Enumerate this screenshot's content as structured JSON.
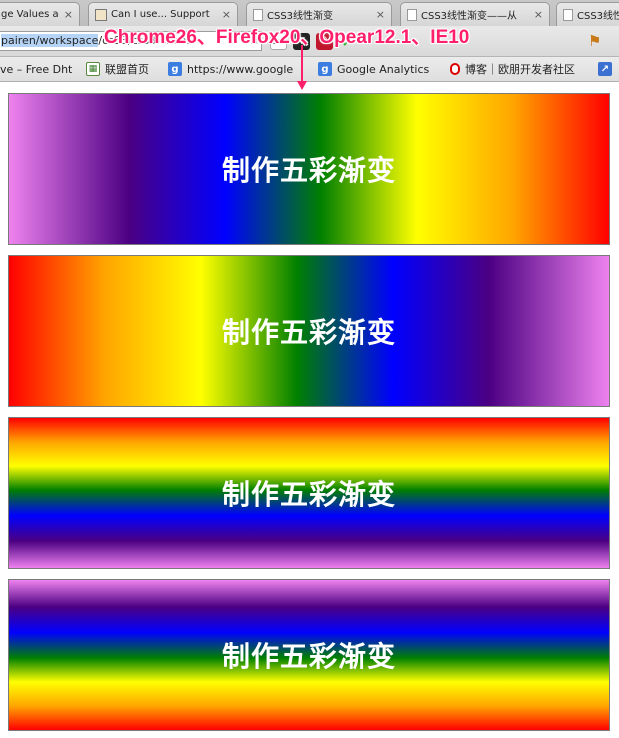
{
  "tabs": [
    {
      "label": "ge Values a",
      "icon": "none"
    },
    {
      "label": "Can I use... Support",
      "icon": "favicon-icon"
    },
    {
      "label": "CSS3线性渐变",
      "icon": "document-icon"
    },
    {
      "label": "CSS3线性渐变——从",
      "icon": "document-icon"
    },
    {
      "label": "CSS3线性",
      "icon": "document-icon"
    }
  ],
  "tab_close_glyph": "×",
  "address_bar": {
    "selected_text": "pairen/workspace",
    "rest_text": "/csS3/css3-linear"
  },
  "toolbar": {
    "star_glyph": "☆",
    "extensions": [
      {
        "name": "css-extension-icon",
        "label": "css"
      },
      {
        "name": "v-extension-icon",
        "label": "▼"
      },
      {
        "name": "red-extension-icon",
        "label": "9"
      },
      {
        "name": "green-check-icon",
        "label": "✓"
      }
    ],
    "flag_glyph": "⚑"
  },
  "bookmarks": [
    {
      "label": "ve – Free Dht",
      "icon": "none"
    },
    {
      "label": "联盟首页",
      "icon": "grid-icon"
    },
    {
      "label": "https://www.google",
      "icon": "google-icon"
    },
    {
      "label": "Google Analytics",
      "icon": "google-icon"
    },
    {
      "label": "博客｜欧朋开发者社区",
      "icon": "opera-icon"
    },
    {
      "label": "",
      "icon": "chart-icon"
    }
  ],
  "annotation": {
    "text": "Chrome26、Firefox20、Opear12.1、IE10",
    "color": "#ff1f6b"
  },
  "demos": [
    {
      "text": "制作五彩渐变",
      "direction": "left-to-right"
    },
    {
      "text": "制作五彩渐变",
      "direction": "right-to-left"
    },
    {
      "text": "制作五彩渐变",
      "direction": "bottom-to-top"
    },
    {
      "text": "制作五彩渐变",
      "direction": "top-to-bottom"
    }
  ],
  "rainbow_colors": [
    "#ee82ee",
    "#4b0082",
    "#0000ff",
    "#008000",
    "#ffff00",
    "#ffa500",
    "#ff0000"
  ]
}
